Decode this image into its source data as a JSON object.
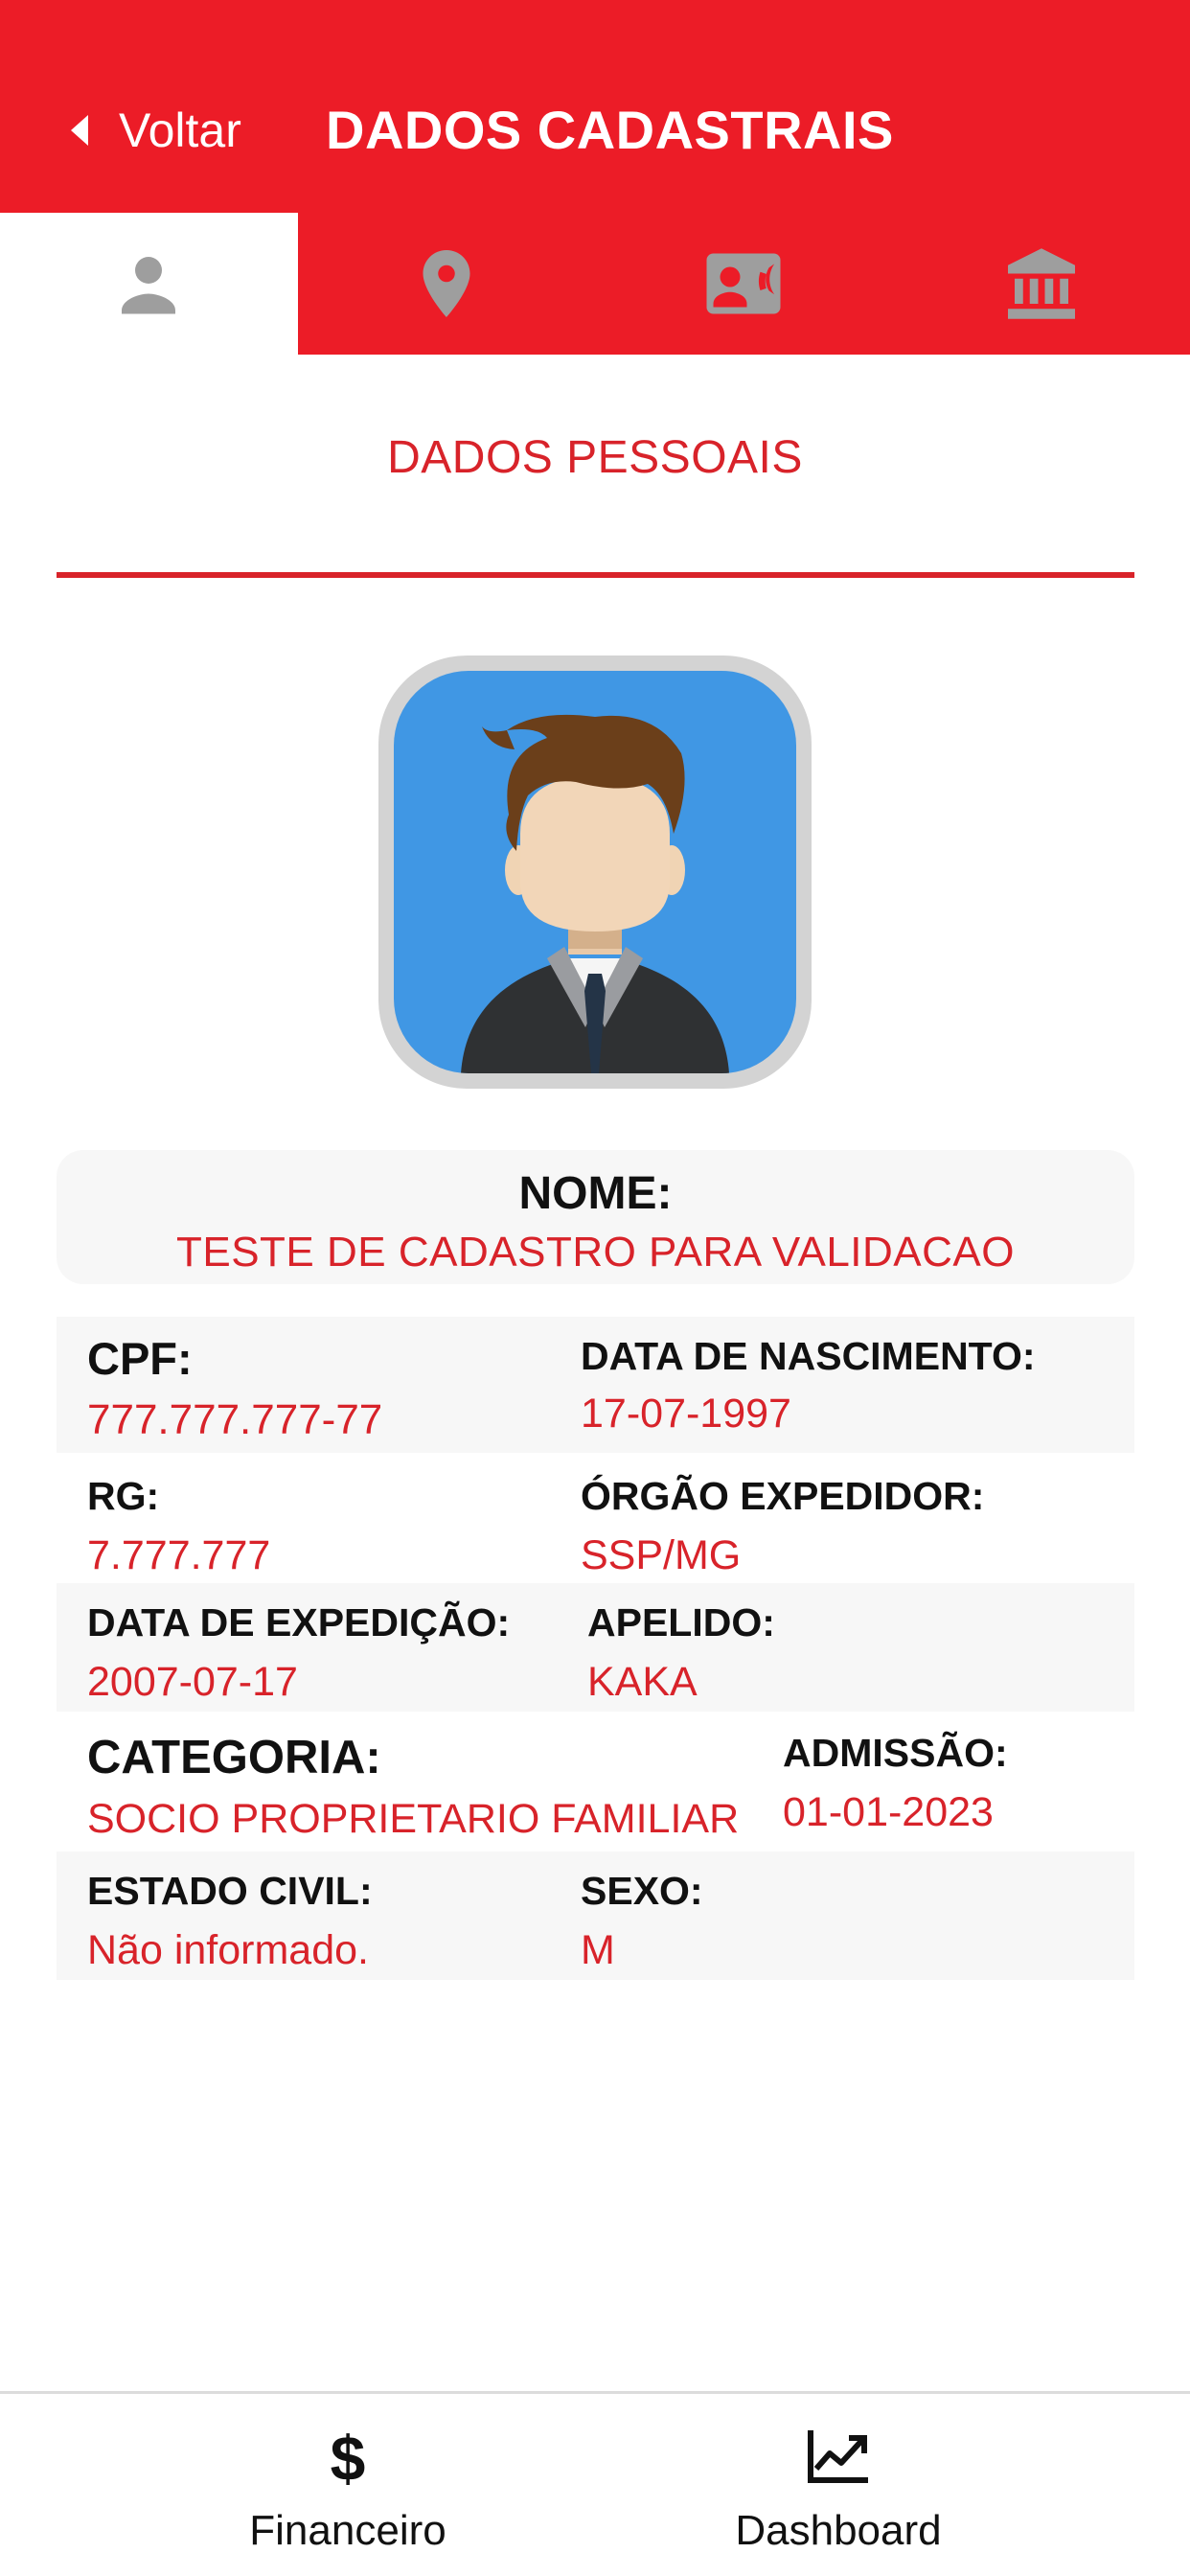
{
  "header": {
    "back_label": "Voltar",
    "title": "DADOS CADASTRAIS",
    "color": "#ec1c27"
  },
  "tabs": [
    {
      "icon": "person-icon",
      "active": true
    },
    {
      "icon": "location-pin-icon",
      "active": false
    },
    {
      "icon": "contact-card-icon",
      "active": false
    },
    {
      "icon": "bank-icon",
      "active": false
    }
  ],
  "section": {
    "title": "DADOS PESSOAIS",
    "accent": "#d8232a"
  },
  "avatar": {
    "icon": "avatar-man-icon"
  },
  "profile": {
    "name_label": "NOME:",
    "name_value": "TESTE DE CADASTRO PARA VALIDACAO",
    "cpf_label": "CPF:",
    "cpf_value": "777.777.777-77",
    "birth_label": "DATA DE NASCIMENTO:",
    "birth_value": "17-07-1997",
    "rg_label": "RG:",
    "rg_value": "7.777.777",
    "issuer_label": "ÓRGÃO EXPEDIDOR:",
    "issuer_value": "SSP/MG",
    "issue_date_label": "DATA DE EXPEDIÇÃO:",
    "issue_date_value": "2007-07-17",
    "nickname_label": "APELIDO:",
    "nickname_value": "KAKA",
    "category_label": "CATEGORIA:",
    "category_value": "SOCIO PROPRIETARIO FAMILIAR",
    "admission_label": "ADMISSÃO:",
    "admission_value": "01-01-2023",
    "marital_label": "ESTADO CIVIL:",
    "marital_value": "Não informado.",
    "sex_label": "SEXO:",
    "sex_value": "M"
  },
  "bottom_nav": {
    "financeiro": {
      "icon": "dollar-icon",
      "label": "Financeiro"
    },
    "dashboard": {
      "icon": "trending-up-icon",
      "label": "Dashboard"
    }
  }
}
